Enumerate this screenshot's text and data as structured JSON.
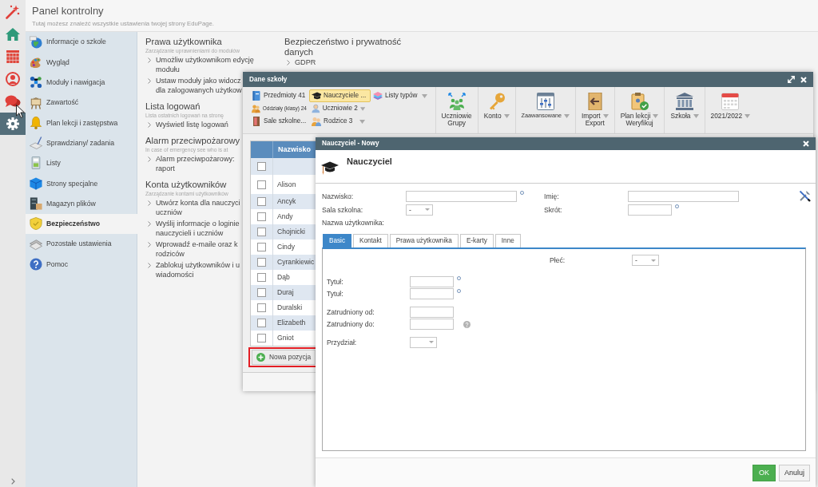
{
  "icon_rail": [
    {
      "selected": false
    },
    {
      "selected": false
    },
    {
      "selected": false
    },
    {
      "selected": false
    },
    {
      "selected": false
    },
    {
      "selected": true
    }
  ],
  "header": {
    "title": "Panel kontrolny",
    "subtitle": "Tutaj możesz znaleźć wszystkie ustawienia twojej strony EduPage."
  },
  "sidebar": {
    "items": [
      {
        "label": "Informacje o szkole",
        "selected": false
      },
      {
        "label": "Wygląd",
        "selected": false
      },
      {
        "label": "Moduły i nawigacja",
        "selected": false
      },
      {
        "label": "Zawartość",
        "selected": false
      },
      {
        "label": "Plan lekcji i zastępstwa",
        "selected": false
      },
      {
        "label": "Sprawdziany/ zadania",
        "selected": false
      },
      {
        "label": "Listy",
        "selected": false
      },
      {
        "label": "Strony specjalne",
        "selected": false
      },
      {
        "label": "Magazyn plików",
        "selected": false
      },
      {
        "label": "Bezpieczeństwo",
        "selected": true
      },
      {
        "label": "Pozostałe ustawienia",
        "selected": false
      },
      {
        "label": "Pomoc",
        "selected": false
      }
    ]
  },
  "settings": {
    "columns": [
      [
        {
          "title": "Prawa użytkownika",
          "subtitle": "Zarządzanie uprawnieniami do modułów",
          "links": [
            "Umożliw użytkownikom edycję\nmodułu",
            "Ustaw moduły jako widocz\ndla zalogowanych użytkow"
          ]
        },
        {
          "title": "Lista logowań",
          "subtitle": "Lista ostatnich logowań na stronę",
          "links": [
            "Wyświetl listę logowań"
          ]
        },
        {
          "title": "Alarm przeciwpożarowy",
          "subtitle": "In case of emergency see who is at",
          "links": [
            "Alarm przeciwpożarowy:\nraport"
          ]
        },
        {
          "title": "Konta użytkowników",
          "subtitle": "Zarządzanie kontami użytkowników",
          "links": [
            "Utwórz konta dla nauczyci\nuczniów",
            "Wyślij informacje o loginie\nnauczycieli i uczniów",
            "Wprowadź e-maile oraz k\nrodziców",
            "Zablokuj użytkowników i u\nwiadomości"
          ]
        }
      ],
      [
        {
          "title": "Bezpieczeństwo i prywatność\ndanych",
          "links": [
            "GDPR"
          ]
        }
      ]
    ]
  },
  "school_window": {
    "title": "Dane szkoły",
    "quick_columns": [
      [
        {
          "label": "Przedmioty 41",
          "selected": false,
          "dropdown": false
        },
        {
          "label": "Oddziały (klasy) 24",
          "selected": false,
          "dropdown": false
        },
        {
          "label": "Sale szkolne...",
          "selected": false,
          "dropdown": false
        }
      ],
      [
        {
          "label": "Nauczyciele ...",
          "selected": true,
          "dropdown": false
        },
        {
          "label": "Uczniowie 2",
          "selected": false,
          "dropdown": true
        },
        {
          "label": "Rodzice 3",
          "selected": false,
          "dropdown": true
        }
      ],
      [
        {
          "label": "Listy typów",
          "selected": false,
          "dropdown": true
        }
      ]
    ],
    "tools": [
      {
        "lines": [
          "Uczniowie",
          "Grupy"
        ],
        "dropdown": false
      },
      {
        "lines": [
          "Konto"
        ],
        "dropdown": true
      },
      {
        "lines": [
          "Zaawansowane"
        ],
        "dropdown": true
      },
      {
        "lines": [
          "Import",
          "Export"
        ],
        "dropdown": true
      },
      {
        "lines": [
          "Plan lekcji",
          "Weryfikuj"
        ],
        "dropdown": true
      },
      {
        "lines": [
          "Szkoła"
        ],
        "dropdown": true
      },
      {
        "lines": [
          "2021/2022"
        ],
        "dropdown": true
      }
    ],
    "table": {
      "columns": [
        "Nazwisko"
      ],
      "rows": [
        {
          "checked": false
        },
        {
          "name": "Alison",
          "checked": false
        },
        {
          "name": "Ancyk",
          "checked": false
        },
        {
          "name": "Andy",
          "checked": false
        },
        {
          "name": "Chojnicki",
          "checked": false
        },
        {
          "name": "Cindy",
          "checked": false
        },
        {
          "name": "Cyrankiewic",
          "checked": false
        },
        {
          "name": "Dąb",
          "checked": false
        },
        {
          "name": "Duraj",
          "checked": false
        },
        {
          "name": "Duralski",
          "checked": false
        },
        {
          "name": "Elizabeth",
          "checked": false
        },
        {
          "name": "Gniot",
          "checked": false
        }
      ]
    },
    "add_button": {
      "label": "Nowa pozycja",
      "highlighted": true
    }
  },
  "teacher_dialog": {
    "title": "Nauczyciel - Nowy",
    "heading": "Nauczyciel",
    "fields": [
      {
        "label": "Nazwisko:",
        "kind": "text",
        "required": true
      },
      {
        "label": "Imię:",
        "kind": "text",
        "required": false
      },
      {
        "label": "Sala szkolna:",
        "kind": "select",
        "value": "-"
      },
      {
        "label": "Skrót:",
        "kind": "text",
        "required": true
      },
      {
        "label": "Nazwa użytkownika:",
        "kind": "label"
      }
    ],
    "tabs": [
      {
        "label": "Basic",
        "selected": true
      },
      {
        "label": "Kontakt",
        "selected": false
      },
      {
        "label": "Prawa użytkownika",
        "selected": false
      },
      {
        "label": "E-karty",
        "selected": false
      },
      {
        "label": "Inne",
        "selected": false
      }
    ],
    "panel": {
      "side_fields": [
        {
          "label": "Płeć:",
          "kind": "select",
          "value": "-"
        }
      ],
      "groups": [
        [
          {
            "label": "Tytuł:",
            "kind": "text",
            "required": true,
            "help": false
          },
          {
            "label": "Tytuł:",
            "kind": "text",
            "required": true,
            "help": false
          }
        ],
        [
          {
            "label": "Zatrudniony od:",
            "kind": "text",
            "required": false,
            "help": false
          },
          {
            "label": "Zatrudniony do:",
            "kind": "text",
            "required": false,
            "help": true
          }
        ],
        [
          {
            "label": "Przydział:",
            "kind": "select"
          }
        ]
      ]
    },
    "buttons": [
      {
        "label": "OK",
        "kind": "confirm"
      },
      {
        "label": "Anuluj",
        "kind": "cancel"
      }
    ]
  }
}
